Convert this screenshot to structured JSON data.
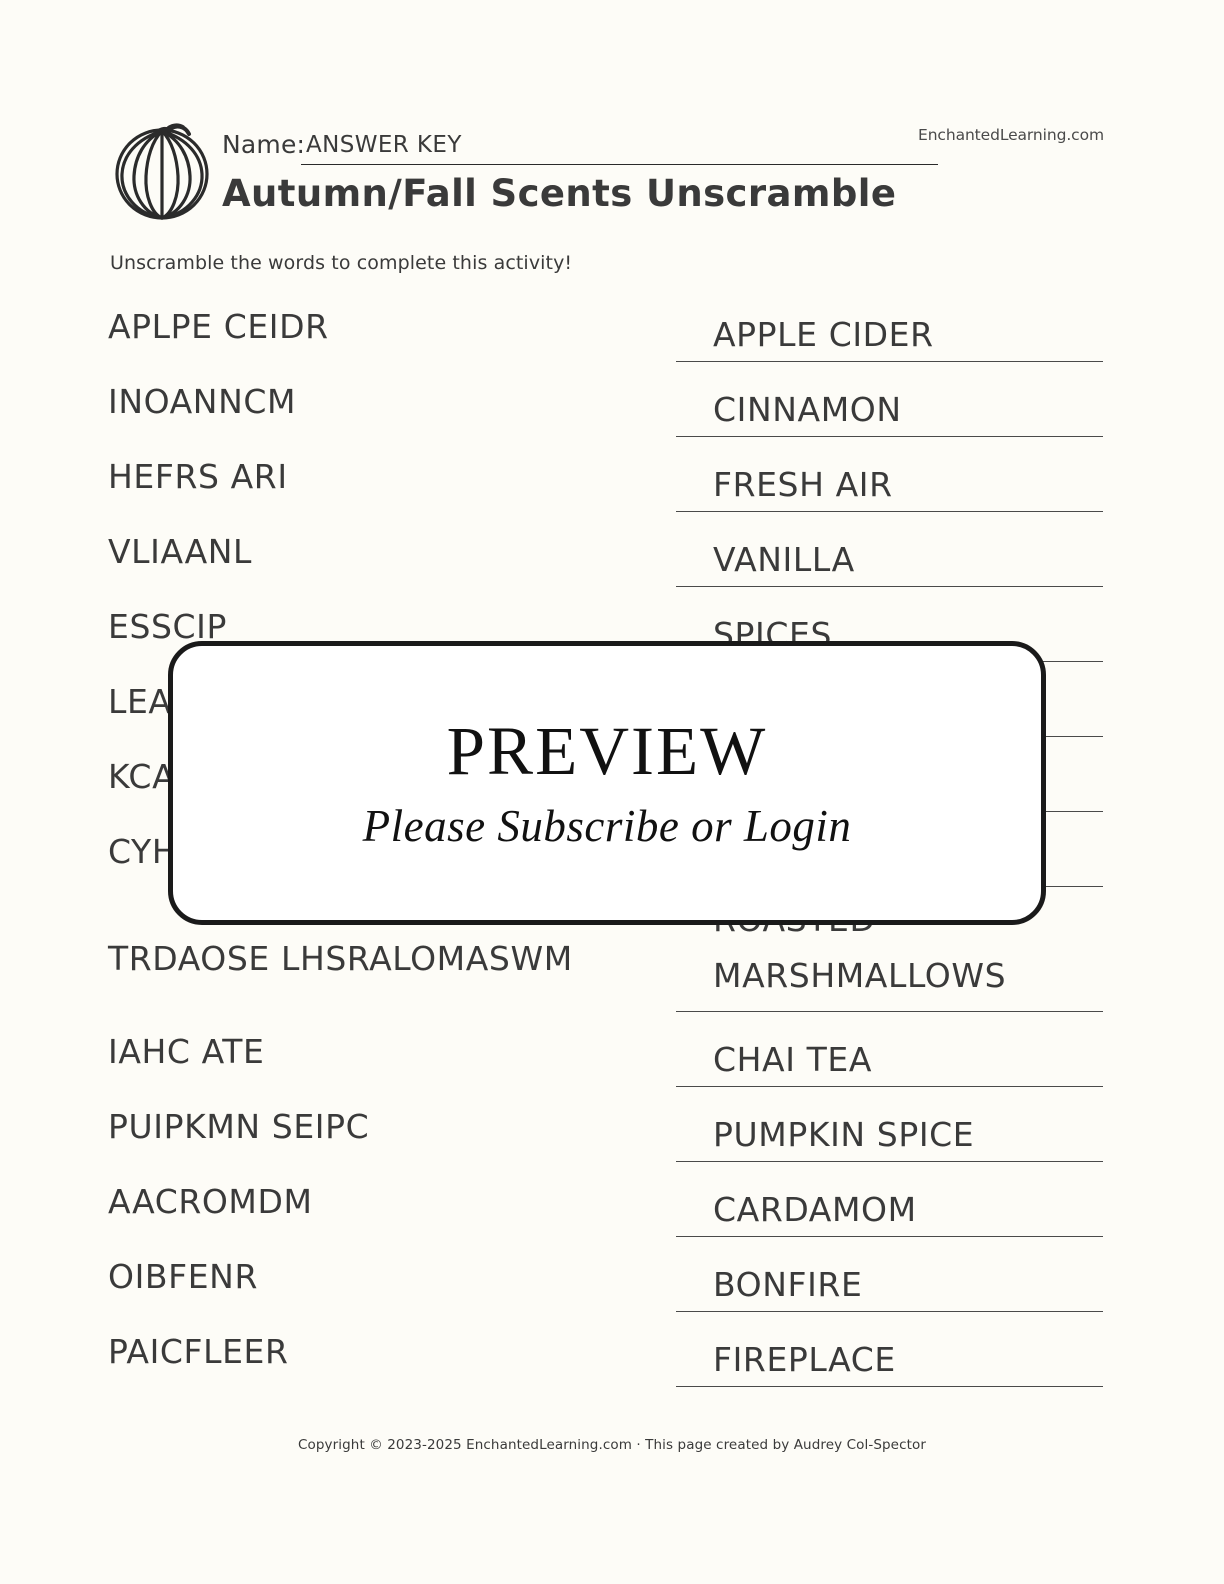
{
  "header": {
    "name_label": "Name:",
    "name_value": "ANSWER KEY",
    "brand": "EnchantedLearning.com",
    "title": "Autumn/Fall Scents Unscramble",
    "pumpkin_icon": "pumpkin-icon"
  },
  "instructions": "Unscramble the words to complete this activity!",
  "rows": [
    {
      "scrambled": "APLPE CEIDR",
      "answer": "APPLE CIDER"
    },
    {
      "scrambled": "INOANNCM",
      "answer": "CINNAMON"
    },
    {
      "scrambled": "HEFRS ARI",
      "answer": "FRESH AIR"
    },
    {
      "scrambled": "VLIAANL",
      "answer": "VANILLA"
    },
    {
      "scrambled": "ESSCIP",
      "answer": "SPICES"
    },
    {
      "scrambled": "LEA",
      "answer": ""
    },
    {
      "scrambled": "KCA",
      "answer": ""
    },
    {
      "scrambled": "CYH",
      "answer": ""
    },
    {
      "scrambled": "TRDAOSE LHSRALOMASWM",
      "answer": "ROASTED\nMARSHMALLOWS"
    },
    {
      "scrambled": "IAHC ATE",
      "answer": "CHAI TEA"
    },
    {
      "scrambled": "PUIPKMN SEIPC",
      "answer": "PUMPKIN SPICE"
    },
    {
      "scrambled": "AACROMDM",
      "answer": "CARDAMOM"
    },
    {
      "scrambled": "OIBFENR",
      "answer": "BONFIRE"
    },
    {
      "scrambled": "PAICFLEER",
      "answer": "FIREPLACE"
    }
  ],
  "overlay": {
    "title": "PREVIEW",
    "subtitle": "Please Subscribe or Login"
  },
  "footer": "Copyright © 2023-2025 EnchantedLearning.com · This page created by Audrey Col-Spector",
  "colors": {
    "page_bg": "#fdfcf7",
    "ink": "#3a3a3a",
    "rule": "#4a4a4a",
    "overlay_border": "#1a1a1a"
  }
}
